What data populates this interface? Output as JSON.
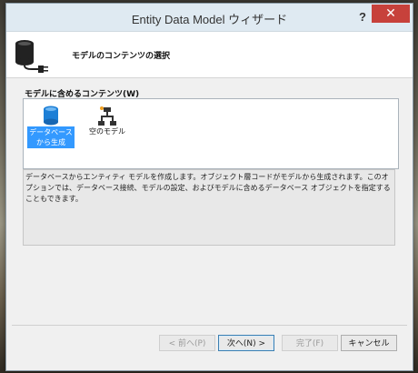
{
  "window": {
    "title": "Entity Data Model ウィザード",
    "help_label": "?",
    "close_label": "✕"
  },
  "header": {
    "title": "モデルのコンテンツの選択",
    "icon": "database-connection-icon"
  },
  "content": {
    "label": "モデルに含めるコンテンツ(W)",
    "items": [
      {
        "label": "データベースから生成",
        "icon": "database-icon",
        "selected": true
      },
      {
        "label": "空のモデル",
        "icon": "empty-model-icon",
        "selected": false
      }
    ],
    "description": "データベースからエンティティ モデルを作成します。オブジェクト層コードがモデルから生成されます。このオプションでは、データベース接続、モデルの設定、およびモデルに含めるデータベース オブジェクトを指定することもできます。"
  },
  "buttons": {
    "back": "< 前へ(P)",
    "next": "次へ(N) >",
    "finish": "完了(F)",
    "cancel": "キャンセル"
  },
  "colors": {
    "selection": "#3399ff",
    "close_button": "#c7413b",
    "titlebar": "#dfeaf2"
  }
}
